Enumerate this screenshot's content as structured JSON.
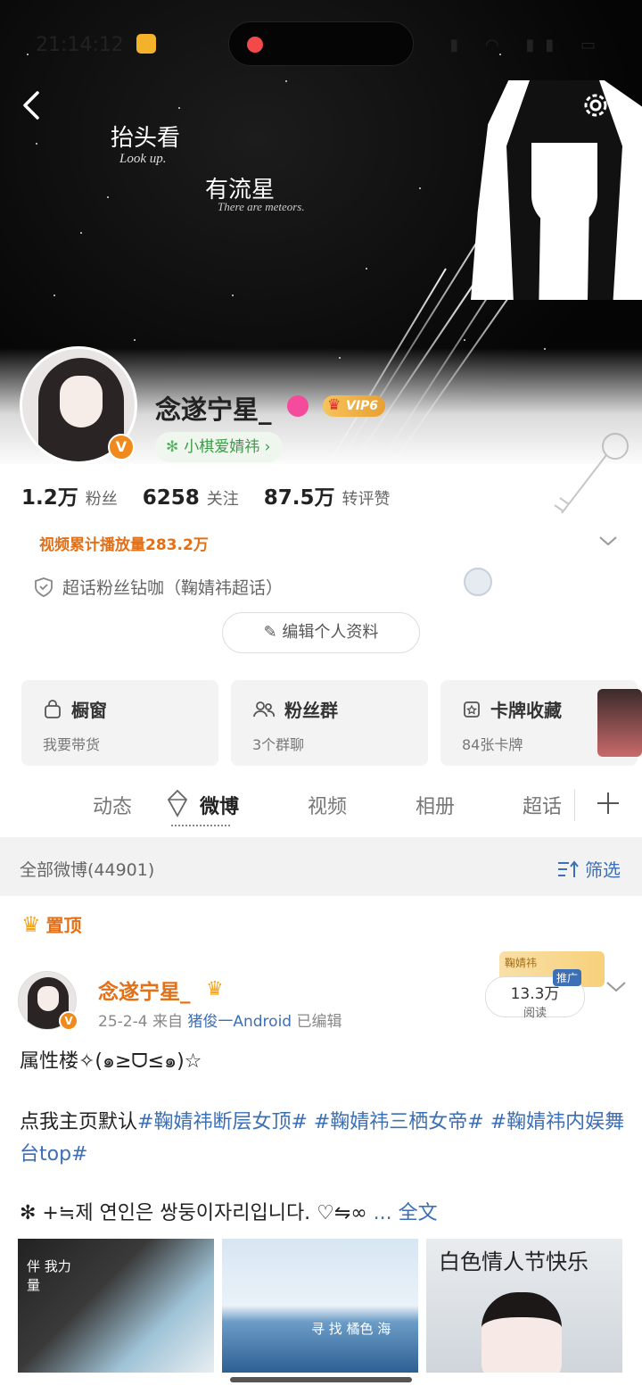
{
  "status_bar": {
    "time": "21:14:12",
    "icons": "▮ ◠ ▮▮ ▭"
  },
  "banner": {
    "line1": "抬头看",
    "line1_en": "Look up.",
    "line2": "有流星",
    "line2_en": "There are meteors."
  },
  "profile": {
    "username": "念遂宁星_",
    "verified": "V",
    "vip": "VIP6",
    "tag": "小棋爱婧祎",
    "stats": [
      {
        "num": "1.2万",
        "label": "粉丝"
      },
      {
        "num": "6258",
        "label": "关注"
      },
      {
        "num": "87.5万",
        "label": "转评赞"
      }
    ],
    "video_plays": "视频累计播放量283.2万",
    "supertopic": "超话粉丝钻咖（鞠婧祎超话）",
    "edit_button": "编辑个人资料"
  },
  "cards": [
    {
      "title": "橱窗",
      "sub": "我要带货"
    },
    {
      "title": "粉丝群",
      "sub": "3个群聊"
    },
    {
      "title": "卡牌收藏",
      "sub": "84张卡牌"
    }
  ],
  "tabs": [
    "动态",
    "微博",
    "视频",
    "相册",
    "超话"
  ],
  "filter_bar": {
    "all": "全部微博(44901)",
    "filter": "筛选"
  },
  "pinned": "置顶",
  "post": {
    "author": "念遂宁星_",
    "date": "25-2-4",
    "from": "来自",
    "source": "猪俊一Android",
    "edited": "已编辑",
    "promo_label": "鞠婧祎",
    "promo_tag": "推广",
    "reads": "13.3万",
    "reads_label": "阅读",
    "line1": "属性楼✧(๑≥ᗜ≤๑)☆",
    "line2_prefix": "点我主页默认",
    "hashtags": "#鞠婧祎断层女顶# #鞠婧祎三栖女帝# #鞠婧祎内娱舞台top#",
    "line3": "✻ +≒제 연인은 쌍둥이자리입니다. ♡⇋∞",
    "more": "... 全文"
  },
  "thumbs": {
    "t1_caption": "伴 我力量",
    "t2_caption": "寻 找 橘色 海",
    "t3_title": "白色情人节快乐"
  },
  "colors": {
    "accent_orange": "#e36f16",
    "link_blue": "#3b6fb6",
    "tag_green": "#3c9a48"
  }
}
